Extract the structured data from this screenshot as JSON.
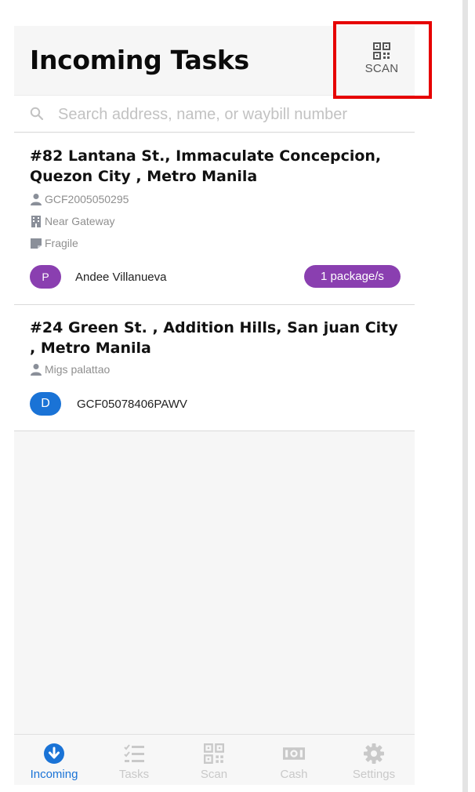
{
  "header": {
    "title": "Incoming Tasks",
    "scan_label": "SCAN",
    "scan_icon": "qr-code-icon"
  },
  "search": {
    "placeholder": "Search address, name, or waybill number",
    "value": "",
    "icon": "search-icon"
  },
  "tasks": [
    {
      "address": "#82 Lantana St., Immaculate Concepcion, Quezon City , Metro Manila",
      "details": [
        {
          "icon": "person-icon",
          "text": "GCF2005050295"
        },
        {
          "icon": "building-icon",
          "text": "Near Gateway"
        },
        {
          "icon": "note-icon",
          "text": "Fragile"
        }
      ],
      "avatar_letter": "P",
      "avatar_color": "#8a3fb0",
      "name": "Andee Villanueva",
      "badge": "1 package/s"
    },
    {
      "address": "#24 Green St. , Addition Hills, San juan City , Metro Manila",
      "details": [
        {
          "icon": "person-icon",
          "text": "Migs palattao"
        }
      ],
      "avatar_letter": "D",
      "avatar_color": "#1a73d6",
      "name": "GCF05078406PAWV"
    }
  ],
  "tabs": [
    {
      "label": "Incoming",
      "icon": "download-circle-icon",
      "active": true
    },
    {
      "label": "Tasks",
      "icon": "checklist-icon",
      "active": false
    },
    {
      "label": "Scan",
      "icon": "qr-code-icon",
      "active": false
    },
    {
      "label": "Cash",
      "icon": "cash-icon",
      "active": false
    },
    {
      "label": "Settings",
      "icon": "gear-icon",
      "active": false
    }
  ],
  "colors": {
    "accent": "#1a73d6",
    "purple": "#8a3fb0",
    "highlight": "#e60000",
    "inactive_tab": "#c9c9c9"
  }
}
